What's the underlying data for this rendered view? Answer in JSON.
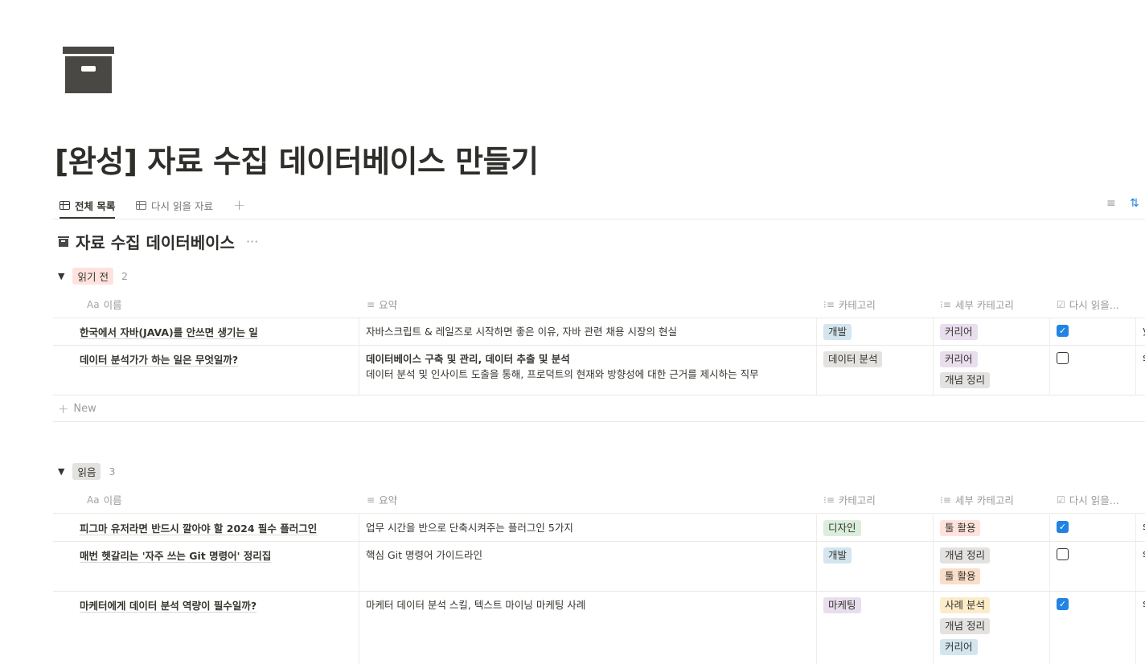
{
  "page": {
    "title": "[완성] 자료 수집 데이터베이스 만들기",
    "icon": "archive-box-icon"
  },
  "views": [
    {
      "label": "전체 목록",
      "icon": "table-icon",
      "active": true
    },
    {
      "label": "다시 읽을 자료",
      "icon": "table-icon",
      "active": false
    }
  ],
  "add_view_label": "+",
  "toolbar": {
    "filter_icon": "≡",
    "sort_icon": "⇅"
  },
  "database": {
    "title": "자료 수집 데이터베이스",
    "more": "···",
    "icon": "archive-box-icon"
  },
  "columns": {
    "name": {
      "icon": "Aa",
      "label": "이름"
    },
    "summary": {
      "icon": "≡",
      "label": "요약"
    },
    "category": {
      "icon": "⁝≡",
      "label": "카테고리"
    },
    "subcategory": {
      "icon": "⁝≡",
      "label": "세부 카테고리"
    },
    "reread": {
      "icon": "☑",
      "label": "다시 읽을..."
    }
  },
  "colors": {
    "gray_tag": "#e3e2e0",
    "red_tag": "#ffe2dd",
    "green_tag": "#dbeddb",
    "brown_tag": "#eee0da",
    "purple_tag": "#e8deee",
    "blue_tag": "#d3e5ef",
    "orange_tag": "#fadec9",
    "yellow_tag": "#fdecc8",
    "checkbox_on": "#2383e2"
  },
  "groups": [
    {
      "label": "읽기 전",
      "count": "2",
      "rows": [
        {
          "name": "한국에서 자바(JAVA)를 안쓰면 생기는 일",
          "summary": [
            "자바스크립트 & 레일즈로 시작하면 좋은 이유, 자바 관련 채용 시장의 현실"
          ],
          "category": "개발",
          "subcategories": [
            "커리어"
          ],
          "reread": true,
          "edge": "y"
        },
        {
          "name": "데이터 분석가가 하는 일은 무엇일까?",
          "summary": [
            "데이터베이스 구축 및 관리,  데이터 추출 및 분석",
            "데이터 분석 및 인사이트 도출을 통해, 프로덕트의 현재와 방향성에 대한 근거를 제시하는 직무"
          ],
          "category": "데이터 분석",
          "subcategories": [
            "커리어",
            "개념 정리"
          ],
          "reread": false,
          "edge": "s"
        }
      ],
      "new_label": "New"
    },
    {
      "label": "읽음",
      "count": "3",
      "rows": [
        {
          "name": "피그마 유저라면 반드시 깔아야 할 2024 필수 플러그인",
          "summary": [
            "업무 시간을 반으로 단축시켜주는 플러그인 5가지"
          ],
          "category": "디자인",
          "subcategories": [
            "툴 활용"
          ],
          "reread": true,
          "edge": "s"
        },
        {
          "name": "매번 헷갈리는 '자주 쓰는 Git 명령어' 정리집",
          "summary": [
            "핵심 Git 명령어 가이드라인"
          ],
          "category": "개발",
          "subcategories": [
            "개념 정리",
            "툴 활용"
          ],
          "reread": false,
          "edge": "s"
        },
        {
          "name": "마케터에게 데이터 분석 역량이 필수일까?",
          "summary": [
            "마케터 데이터 분석 스킬, 텍스트 마이닝 마케팅 사례"
          ],
          "category": "마케팅",
          "subcategories": [
            "사례 분석",
            "개념 정리",
            "커리어"
          ],
          "reread": true,
          "edge": "s"
        }
      ]
    }
  ]
}
